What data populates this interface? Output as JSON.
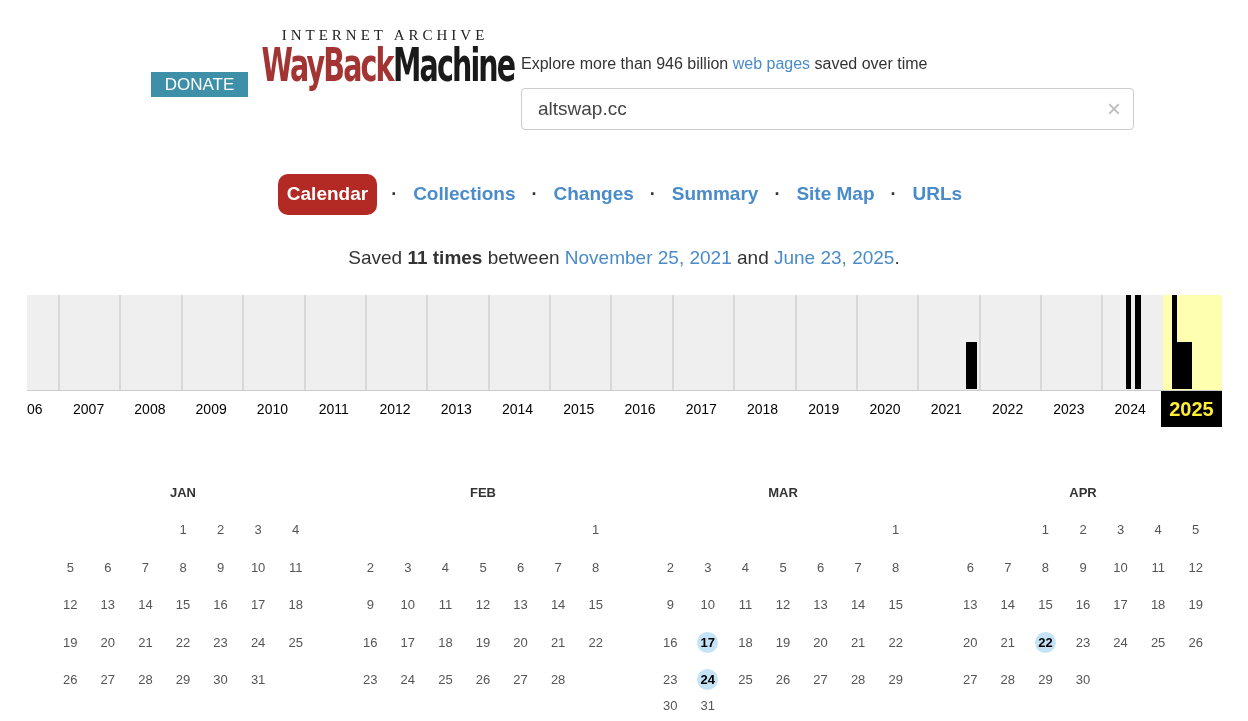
{
  "header": {
    "donate": "DONATE",
    "logo": {
      "top": "INTERNET ARCHIVE",
      "left": "WayBack",
      "right": "Machine"
    },
    "tagline_parts": [
      "Explore more than 946 billion",
      "web pages",
      "saved over time"
    ],
    "search": {
      "value": "altswap.cc",
      "clear": "×"
    }
  },
  "tabs": [
    {
      "label": "Calendar",
      "selected": true
    },
    {
      "label": "Collections",
      "selected": false
    },
    {
      "label": "Changes",
      "selected": false
    },
    {
      "label": "Summary",
      "selected": false
    },
    {
      "label": "Site Map",
      "selected": false
    },
    {
      "label": "URLs",
      "selected": false
    }
  ],
  "tab_separator": "·",
  "summary": {
    "prefix": "Saved",
    "count": "11 times",
    "middle": "between",
    "first": "November 25, 2021",
    "and": "and",
    "last": "June 23, 2025",
    "end": "."
  },
  "years": [
    {
      "label": "06",
      "selected": false
    },
    {
      "label": "2007",
      "selected": false
    },
    {
      "label": "2008",
      "selected": false
    },
    {
      "label": "2009",
      "selected": false
    },
    {
      "label": "2010",
      "selected": false
    },
    {
      "label": "2011",
      "selected": false
    },
    {
      "label": "2012",
      "selected": false
    },
    {
      "label": "2013",
      "selected": false
    },
    {
      "label": "2014",
      "selected": false
    },
    {
      "label": "2015",
      "selected": false
    },
    {
      "label": "2016",
      "selected": false
    },
    {
      "label": "2017",
      "selected": false
    },
    {
      "label": "2018",
      "selected": false
    },
    {
      "label": "2019",
      "selected": false
    },
    {
      "label": "2020",
      "selected": false
    },
    {
      "label": "2021",
      "selected": false
    },
    {
      "label": "2022",
      "selected": false
    },
    {
      "label": "2023",
      "selected": false
    },
    {
      "label": "2024",
      "selected": false
    },
    {
      "label": "2025",
      "selected": true
    }
  ],
  "months": [
    {
      "name": "JAN",
      "weeks": [
        [
          {
            "d": "1",
            "captured": false
          },
          {
            "d": "2",
            "captured": false
          },
          {
            "d": "3",
            "captured": false
          },
          {
            "d": "4",
            "captured": false
          }
        ],
        [
          {
            "d": "5",
            "captured": false
          },
          {
            "d": "6",
            "captured": false
          },
          {
            "d": "7",
            "captured": false
          },
          {
            "d": "8",
            "captured": false
          },
          {
            "d": "9",
            "captured": false
          },
          {
            "d": "10",
            "captured": false
          },
          {
            "d": "11",
            "captured": false
          }
        ],
        [
          {
            "d": "12",
            "captured": false
          },
          {
            "d": "13",
            "captured": false
          },
          {
            "d": "14",
            "captured": false
          },
          {
            "d": "15",
            "captured": false
          },
          {
            "d": "16",
            "captured": false
          },
          {
            "d": "17",
            "captured": false
          },
          {
            "d": "18",
            "captured": false
          }
        ],
        [
          {
            "d": "19",
            "captured": false
          },
          {
            "d": "20",
            "captured": false
          },
          {
            "d": "21",
            "captured": false
          },
          {
            "d": "22",
            "captured": false
          },
          {
            "d": "23",
            "captured": false
          },
          {
            "d": "24",
            "captured": false
          },
          {
            "d": "25",
            "captured": false
          }
        ],
        [
          {
            "d": "26",
            "captured": false
          },
          {
            "d": "27",
            "captured": false
          },
          {
            "d": "28",
            "captured": false
          },
          {
            "d": "29",
            "captured": false
          },
          {
            "d": "30",
            "captured": false
          },
          {
            "d": "31",
            "captured": false
          }
        ]
      ]
    },
    {
      "name": "FEB",
      "weeks": [
        [
          {
            "d": "1",
            "captured": false
          }
        ],
        [
          {
            "d": "2",
            "captured": false
          },
          {
            "d": "3",
            "captured": false
          },
          {
            "d": "4",
            "captured": false
          },
          {
            "d": "5",
            "captured": false
          },
          {
            "d": "6",
            "captured": false
          },
          {
            "d": "7",
            "captured": false
          },
          {
            "d": "8",
            "captured": false
          }
        ],
        [
          {
            "d": "9",
            "captured": false
          },
          {
            "d": "10",
            "captured": false
          },
          {
            "d": "11",
            "captured": false
          },
          {
            "d": "12",
            "captured": false
          },
          {
            "d": "13",
            "captured": false
          },
          {
            "d": "14",
            "captured": false
          },
          {
            "d": "15",
            "captured": false
          }
        ],
        [
          {
            "d": "16",
            "captured": false
          },
          {
            "d": "17",
            "captured": false
          },
          {
            "d": "18",
            "captured": false
          },
          {
            "d": "19",
            "captured": false
          },
          {
            "d": "20",
            "captured": false
          },
          {
            "d": "21",
            "captured": false
          },
          {
            "d": "22",
            "captured": false
          }
        ],
        [
          {
            "d": "23",
            "captured": false
          },
          {
            "d": "24",
            "captured": false
          },
          {
            "d": "25",
            "captured": false
          },
          {
            "d": "26",
            "captured": false
          },
          {
            "d": "27",
            "captured": false
          },
          {
            "d": "28",
            "captured": false
          }
        ]
      ]
    },
    {
      "name": "MAR",
      "weeks": [
        [
          {
            "d": "1",
            "captured": false
          }
        ],
        [
          {
            "d": "2",
            "captured": false
          },
          {
            "d": "3",
            "captured": false
          },
          {
            "d": "4",
            "captured": false
          },
          {
            "d": "5",
            "captured": false
          },
          {
            "d": "6",
            "captured": false
          },
          {
            "d": "7",
            "captured": false
          },
          {
            "d": "8",
            "captured": false
          }
        ],
        [
          {
            "d": "9",
            "captured": false
          },
          {
            "d": "10",
            "captured": false
          },
          {
            "d": "11",
            "captured": false
          },
          {
            "d": "12",
            "captured": false
          },
          {
            "d": "13",
            "captured": false
          },
          {
            "d": "14",
            "captured": false
          },
          {
            "d": "15",
            "captured": false
          }
        ],
        [
          {
            "d": "16",
            "captured": false
          },
          {
            "d": "17",
            "captured": true
          },
          {
            "d": "18",
            "captured": false
          },
          {
            "d": "19",
            "captured": false
          },
          {
            "d": "20",
            "captured": false
          },
          {
            "d": "21",
            "captured": false
          },
          {
            "d": "22",
            "captured": false
          }
        ],
        [
          {
            "d": "23",
            "captured": false
          },
          {
            "d": "24",
            "captured": true
          },
          {
            "d": "25",
            "captured": false
          },
          {
            "d": "26",
            "captured": false
          },
          {
            "d": "27",
            "captured": false
          },
          {
            "d": "28",
            "captured": false
          },
          {
            "d": "29",
            "captured": false
          }
        ],
        [
          {
            "d": "30",
            "captured": false
          },
          {
            "d": "31",
            "captured": false
          }
        ]
      ]
    },
    {
      "name": "APR",
      "weeks": [
        [
          {
            "d": "1",
            "captured": false
          },
          {
            "d": "2",
            "captured": false
          },
          {
            "d": "3",
            "captured": false
          },
          {
            "d": "4",
            "captured": false
          },
          {
            "d": "5",
            "captured": false
          }
        ],
        [
          {
            "d": "6",
            "captured": false
          },
          {
            "d": "7",
            "captured": false
          },
          {
            "d": "8",
            "captured": false
          },
          {
            "d": "9",
            "captured": false
          },
          {
            "d": "10",
            "captured": false
          },
          {
            "d": "11",
            "captured": false
          },
          {
            "d": "12",
            "captured": false
          }
        ],
        [
          {
            "d": "13",
            "captured": false
          },
          {
            "d": "14",
            "captured": false
          },
          {
            "d": "15",
            "captured": false
          },
          {
            "d": "16",
            "captured": false
          },
          {
            "d": "17",
            "captured": false
          },
          {
            "d": "18",
            "captured": false
          },
          {
            "d": "19",
            "captured": false
          }
        ],
        [
          {
            "d": "20",
            "captured": false
          },
          {
            "d": "21",
            "captured": false
          },
          {
            "d": "22",
            "captured": true
          },
          {
            "d": "23",
            "captured": false
          },
          {
            "d": "24",
            "captured": false
          },
          {
            "d": "25",
            "captured": false
          },
          {
            "d": "26",
            "captured": false
          }
        ],
        [
          {
            "d": "27",
            "captured": false
          },
          {
            "d": "28",
            "captured": false
          },
          {
            "d": "29",
            "captured": false
          },
          {
            "d": "30",
            "captured": false
          }
        ]
      ]
    }
  ]
}
